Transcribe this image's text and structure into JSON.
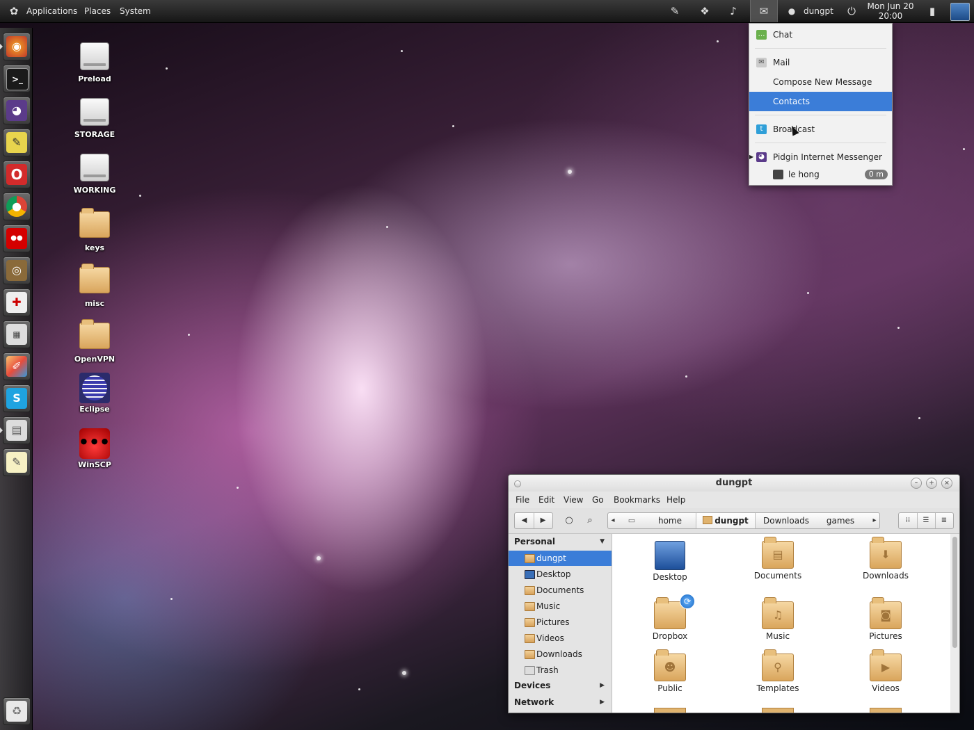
{
  "top_panel": {
    "menus": [
      "Applications",
      "Places",
      "System"
    ],
    "user": "dungpt",
    "clock_date": "Mon Jun 20",
    "clock_time": "20:00",
    "icons": [
      "gnome-foot-icon",
      "pin-icon",
      "dropbox-icon",
      "volume-icon",
      "mail-icon",
      "chat-status-icon",
      "power-icon",
      "signal-icon",
      "workspace-icon"
    ]
  },
  "dock": {
    "items": [
      "firefox",
      "terminal",
      "pidgin",
      "text-editor",
      "opera",
      "chrome",
      "ladybug",
      "speaker",
      "system-tool",
      "calculator",
      "paint",
      "skype",
      "file-cabinet",
      "notepad"
    ],
    "trash": "trash"
  },
  "desktop_icons": [
    {
      "label": "Preload",
      "kind": "drive"
    },
    {
      "label": "STORAGE",
      "kind": "drive"
    },
    {
      "label": "WORKING",
      "kind": "drive"
    },
    {
      "label": "keys",
      "kind": "folder"
    },
    {
      "label": "misc",
      "kind": "folder"
    },
    {
      "label": "OpenVPN",
      "kind": "folder"
    },
    {
      "label": "Eclipse",
      "kind": "app"
    },
    {
      "label": "WinSCP",
      "kind": "app"
    }
  ],
  "indicator_menu": {
    "items": [
      {
        "label": "Chat",
        "icon": "chat-icon"
      },
      {
        "label": "Mail",
        "icon": "mail-icon"
      },
      {
        "label": "Compose New Message"
      },
      {
        "label": "Contacts",
        "selected": true
      },
      {
        "label": "Broadcast",
        "icon": "broadcast-icon"
      },
      {
        "label": "Pidgin Internet Messenger",
        "icon": "pidgin-icon"
      },
      {
        "label": "le hong",
        "badge": "0 m"
      }
    ]
  },
  "file_manager": {
    "title": "dungpt",
    "menus": [
      "File",
      "Edit",
      "View",
      "Go",
      "Bookmarks",
      "Help"
    ],
    "breadcrumbs": [
      "home",
      "dungpt",
      "Downloads",
      "games"
    ],
    "active_crumb": "dungpt",
    "sidebar": {
      "personal_header": "Personal",
      "items": [
        "dungpt",
        "Desktop",
        "Documents",
        "Music",
        "Pictures",
        "Videos",
        "Downloads",
        "Trash"
      ],
      "selected": "dungpt",
      "devices_header": "Devices",
      "network_header": "Network"
    },
    "grid_items": [
      "Desktop",
      "Documents",
      "Downloads",
      "Dropbox",
      "Music",
      "Pictures",
      "Public",
      "Templates",
      "Videos"
    ]
  }
}
